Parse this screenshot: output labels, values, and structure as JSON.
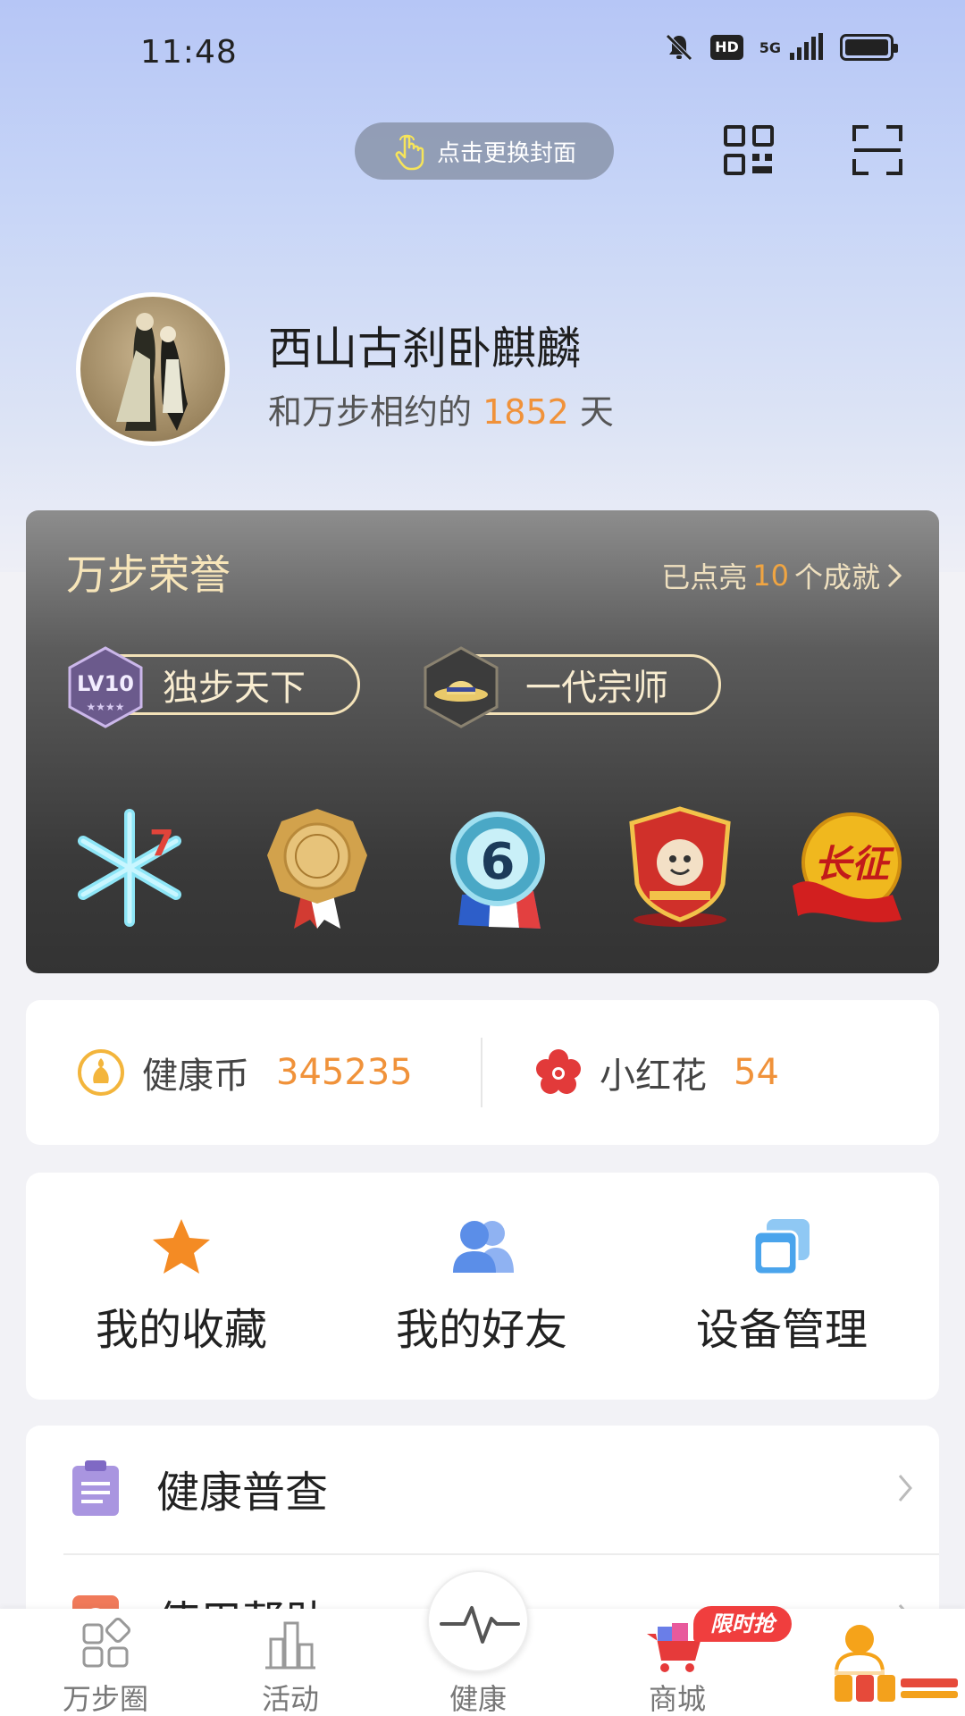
{
  "status_bar": {
    "time": "11:48",
    "hd": "HD",
    "network": "5G"
  },
  "header": {
    "change_cover_label": "点击更换封面"
  },
  "profile": {
    "username": "西山古刹卧麒麟",
    "days_prefix": "和万步相约的",
    "days_count": "1852",
    "days_suffix": "天"
  },
  "honor": {
    "title": "万步荣誉",
    "lit_prefix": "已点亮",
    "lit_count": "10",
    "lit_suffix": "个成就",
    "titles": [
      {
        "badge_text": "LV10",
        "label": "独步天下"
      },
      {
        "label": "一代宗师"
      }
    ],
    "medals": [
      {
        "icon": "snowflake-medal-icon",
        "number": "7"
      },
      {
        "icon": "gold-medal-icon"
      },
      {
        "icon": "number-six-medal-icon",
        "number": "6"
      },
      {
        "icon": "team-captain-shield-icon"
      },
      {
        "icon": "long-march-medal-icon",
        "text": "长征"
      }
    ]
  },
  "wallet": {
    "coin_label": "健康币",
    "coin_value": "345235",
    "flower_label": "小红花",
    "flower_value": "54"
  },
  "quick_actions": [
    {
      "label": "我的收藏",
      "icon": "star-icon"
    },
    {
      "label": "我的好友",
      "icon": "friends-icon"
    },
    {
      "label": "设备管理",
      "icon": "device-icon"
    }
  ],
  "menu": [
    {
      "label": "健康普查",
      "icon": "clipboard-icon"
    },
    {
      "label": "使用帮助",
      "icon": "help-icon"
    }
  ],
  "bottom_nav": {
    "items": [
      {
        "label": "万步圈"
      },
      {
        "label": "活动"
      },
      {
        "label": "健康"
      },
      {
        "label": "商城"
      },
      {
        "label": ""
      }
    ],
    "limited_tag": "限时抢"
  },
  "colors": {
    "accent_orange": "#f0923a",
    "gold_text": "#f7e5b9",
    "flower_red": "#e23a3a",
    "icon_blue": "#5b8ee8"
  }
}
